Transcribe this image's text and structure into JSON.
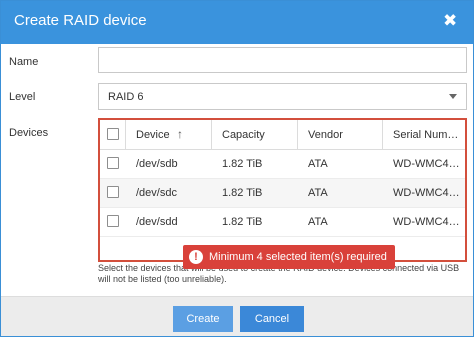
{
  "dialog": {
    "title": "Create RAID device",
    "close_glyph": "✖"
  },
  "form": {
    "name_label": "Name",
    "name_value": "",
    "level_label": "Level",
    "level_value": "RAID 6",
    "devices_label": "Devices"
  },
  "grid": {
    "columns": [
      "Device",
      "Capacity",
      "Vendor",
      "Serial Num…"
    ],
    "sort_glyph": "↑",
    "rows": [
      {
        "device": "/dev/sdb",
        "capacity": "1.82 TiB",
        "vendor": "ATA",
        "serial": "WD-WMC4…"
      },
      {
        "device": "/dev/sdc",
        "capacity": "1.82 TiB",
        "vendor": "ATA",
        "serial": "WD-WMC4…"
      },
      {
        "device": "/dev/sdd",
        "capacity": "1.82 TiB",
        "vendor": "ATA",
        "serial": "WD-WMC4…"
      }
    ]
  },
  "help_text": "Select the devices that will be used to create the RAID device. Devices connected via USB will not be listed (too unreliable).",
  "error": {
    "glyph": "!",
    "message": "Minimum 4 selected item(s) required"
  },
  "footer": {
    "create_label": "Create",
    "cancel_label": "Cancel"
  },
  "colors": {
    "titlebar": "#3a93dd",
    "error": "#d9413a",
    "grid_border_invalid": "#d34f3c",
    "create_button": "#5b9fe3",
    "cancel_button": "#3b88d8"
  },
  "icons": {
    "close": "close-icon",
    "sort": "sort-ascending-icon",
    "dropdown": "chevron-down-icon",
    "error": "error-icon"
  }
}
